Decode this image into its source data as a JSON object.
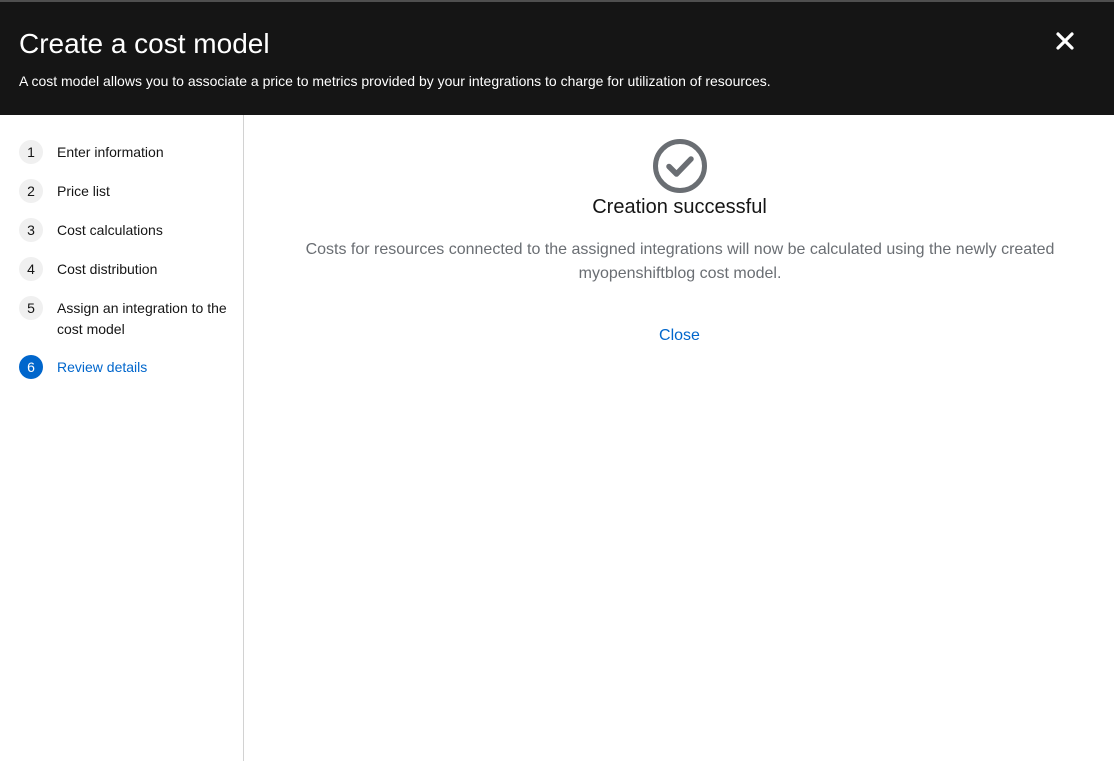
{
  "modal": {
    "title": "Create a cost model",
    "description": "A cost model allows you to associate a price to metrics provided by your integrations to charge for utilization of resources."
  },
  "wizard": {
    "steps": [
      {
        "number": "1",
        "label": "Enter information",
        "current": false
      },
      {
        "number": "2",
        "label": "Price list",
        "current": false
      },
      {
        "number": "3",
        "label": "Cost calculations",
        "current": false
      },
      {
        "number": "4",
        "label": "Cost distribution",
        "current": false
      },
      {
        "number": "5",
        "label": "Assign an integration to the cost model",
        "current": false
      },
      {
        "number": "6",
        "label": "Review details",
        "current": true
      }
    ]
  },
  "result": {
    "icon": "check-circle-icon",
    "title": "Creation successful",
    "message": "Costs for resources connected to the assigned integrations will now be calculated using the newly created myopenshiftblog cost model.",
    "close_label": "Close"
  },
  "colors": {
    "header_bg": "#151515",
    "accent": "#0066cc",
    "icon_gray": "#6a6e73"
  }
}
